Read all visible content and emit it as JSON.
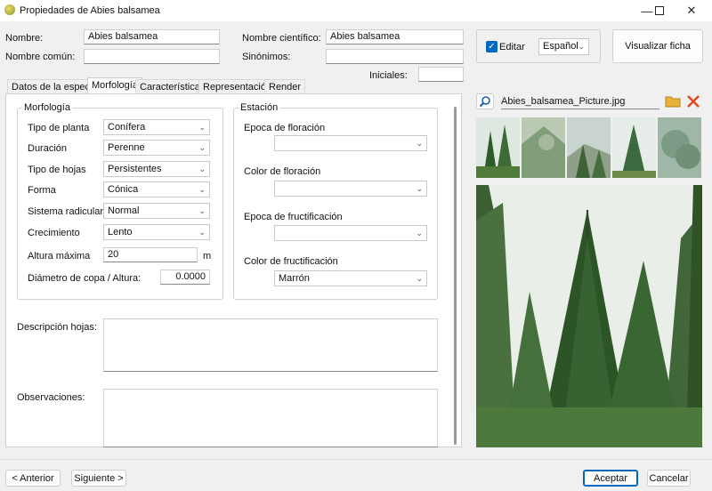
{
  "window": {
    "title": "Propiedades de Abies balsamea"
  },
  "header": {
    "nombre_label": "Nombre:",
    "nombre_value": "Abies balsamea",
    "nombre_comun_label": "Nombre común:",
    "nombre_comun_value": "",
    "nombre_cientifico_label": "Nombre científico:",
    "nombre_cientifico_value": "Abies balsamea",
    "sinonimos_label": "Sinónimos:",
    "sinonimos_value": "",
    "iniciales_label": "Iniciales:",
    "iniciales_value": "",
    "editar_label": "Editar",
    "editar_checked": true,
    "idioma_value": "Español",
    "visualizar_label": "Visualizar ficha"
  },
  "tabs": [
    "Datos de la especie",
    "Morfología",
    "Características",
    "Representación",
    "Render"
  ],
  "active_tab": "Morfología",
  "morfologia": {
    "group_title": "Morfología",
    "rows": [
      {
        "label": "Tipo de planta",
        "value": "Conífera"
      },
      {
        "label": "Duración",
        "value": "Perenne"
      },
      {
        "label": "Tipo de hojas",
        "value": "Persistentes"
      },
      {
        "label": "Forma",
        "value": "Cónica"
      },
      {
        "label": "Sistema radicular",
        "value": "Normal"
      },
      {
        "label": "Crecimiento",
        "value": "Lento"
      }
    ],
    "altura_label": "Altura máxima",
    "altura_value": "20",
    "altura_unit": "m",
    "diametro_label": "Diámetro de copa / Altura:",
    "diametro_value": "0.0000"
  },
  "estacion": {
    "group_title": "Estación",
    "epoca_floracion_label": "Epoca de floración",
    "epoca_floracion_value": "",
    "color_floracion_label": "Color de floración",
    "color_floracion_value": "",
    "epoca_fructificacion_label": "Epoca de fructificación",
    "epoca_fructificacion_value": "",
    "color_fructificacion_label": "Color de fructificación",
    "color_fructificacion_value": "Marrón"
  },
  "descripcion_hojas_label": "Descripción hojas:",
  "observaciones_label": "Observaciones:",
  "picture": {
    "filename": "Abies_balsamea_Picture.jpg"
  },
  "footer": {
    "anterior": "< Anterior",
    "siguiente": "Siguiente >",
    "aceptar": "Aceptar",
    "cancelar": "Cancelar"
  },
  "colors": {
    "accent": "#0067c0",
    "close_red": "#e0491b",
    "folder": "#e8b23a"
  }
}
